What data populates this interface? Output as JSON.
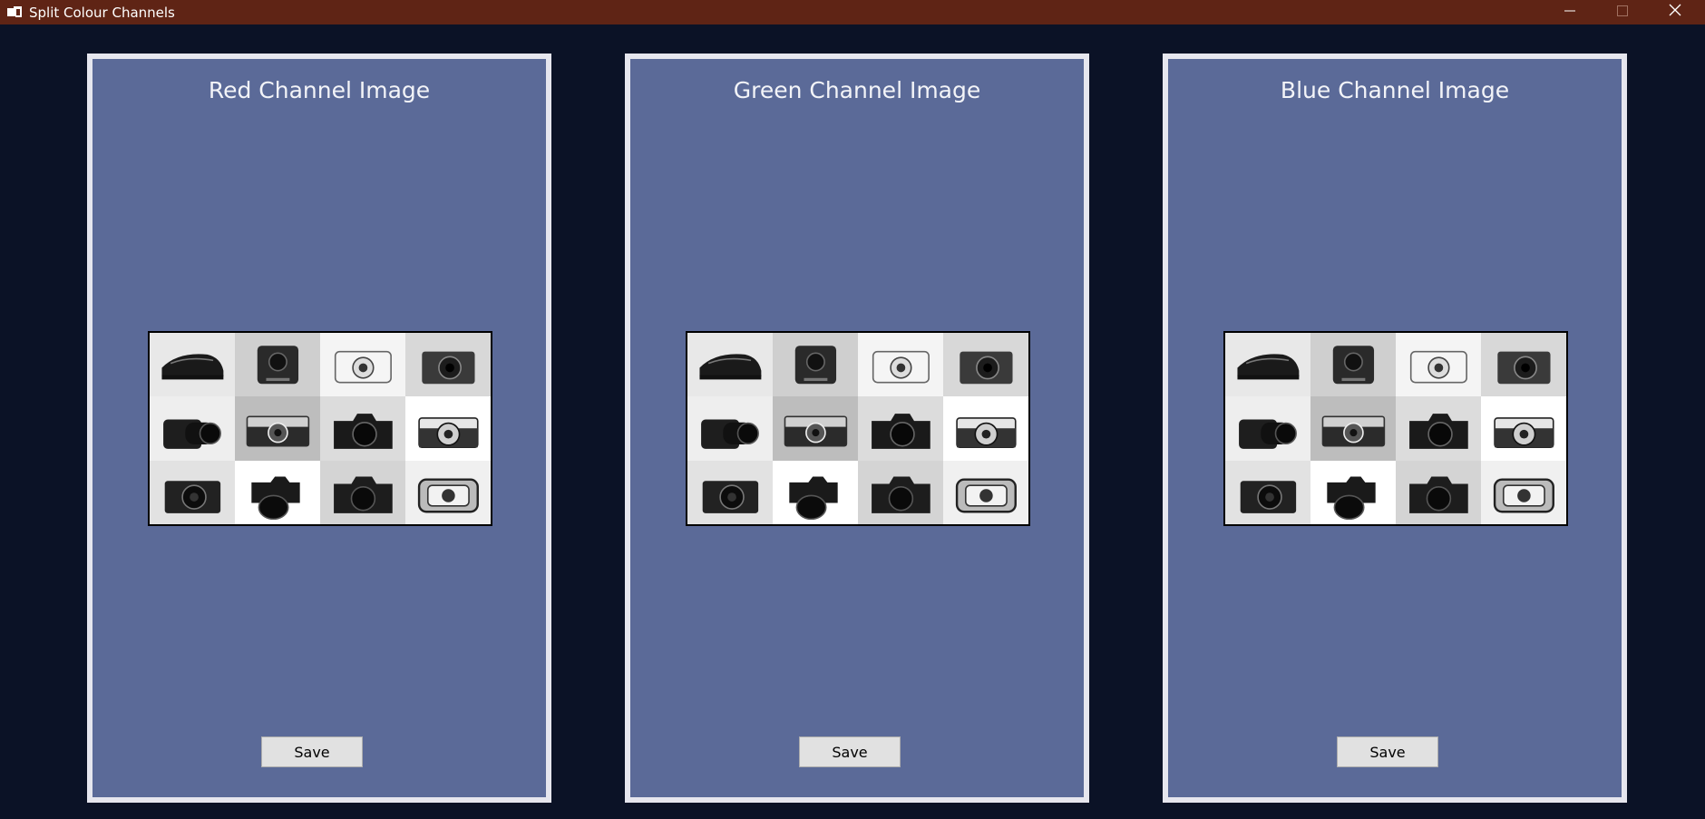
{
  "window": {
    "title": "Split Colour Channels",
    "titlebar_color": "#5f2415",
    "background_color": "#0b1226"
  },
  "panels": [
    {
      "title": "Red Channel Image",
      "save_label": "Save"
    },
    {
      "title": "Green Channel Image",
      "save_label": "Save"
    },
    {
      "title": "Blue Channel Image",
      "save_label": "Save"
    }
  ],
  "panel_color": "#5b6a98",
  "icons": {
    "app": "app-window-icon",
    "minimize": "minimize-icon",
    "maximize": "maximize-icon",
    "close": "close-icon"
  },
  "image_grid": {
    "rows": 3,
    "cols": 4,
    "subjects": [
      "phone-camera",
      "action-camera",
      "compact-camera-silver",
      "compact-camera-dark",
      "bridge-camera",
      "rangefinder-camera",
      "dslr-camera",
      "mirrorless-silver-camera",
      "mirrorless-camera",
      "dslr-large-lens",
      "mirrorless-dark-camera",
      "rugged-camera"
    ]
  }
}
